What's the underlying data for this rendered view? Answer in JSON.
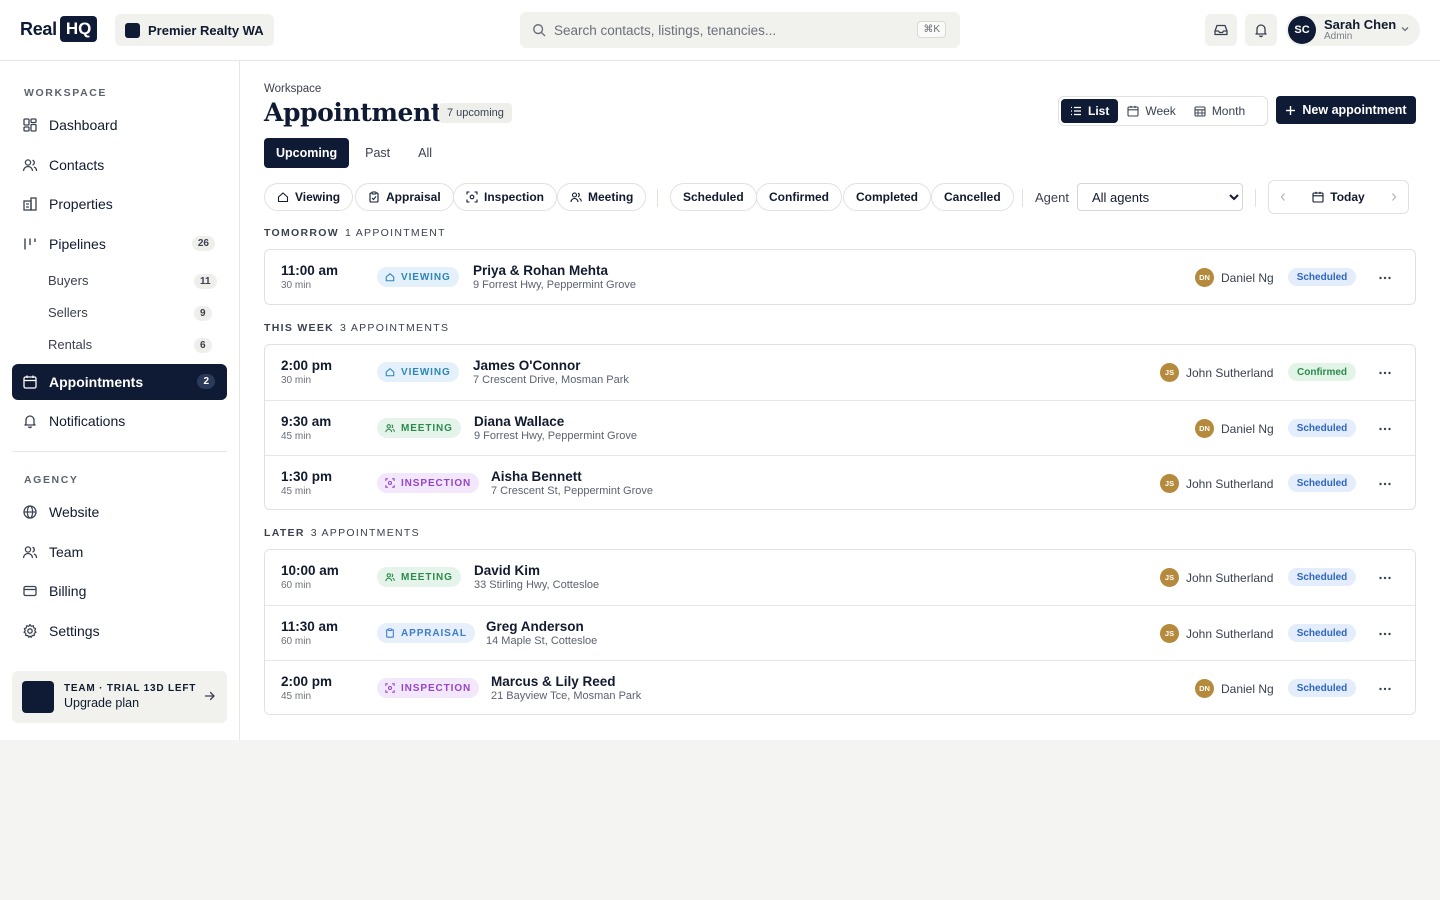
{
  "brand": {
    "real": "Real",
    "hq": "HQ"
  },
  "org": {
    "name": "Premier Realty WA"
  },
  "search": {
    "placeholder": "Search contacts, listings, tenancies...",
    "shortcut": "⌘K"
  },
  "user": {
    "initials": "SC",
    "name": "Sarah Chen",
    "role": "Admin"
  },
  "sidebar": {
    "workspace_label": "WORKSPACE",
    "agency_label": "AGENCY",
    "items": [
      {
        "label": "Dashboard"
      },
      {
        "label": "Contacts"
      },
      {
        "label": "Properties"
      },
      {
        "label": "Pipelines",
        "count": "26"
      },
      {
        "label": "Appointments",
        "count": "2"
      },
      {
        "label": "Notifications"
      }
    ],
    "pipelines": [
      {
        "label": "Buyers",
        "count": "11"
      },
      {
        "label": "Sellers",
        "count": "9"
      },
      {
        "label": "Rentals",
        "count": "6"
      }
    ],
    "agency_items": [
      {
        "label": "Website"
      },
      {
        "label": "Team"
      },
      {
        "label": "Billing"
      },
      {
        "label": "Settings"
      }
    ],
    "upgrade": {
      "line1": "TEAM · TRIAL 13D LEFT",
      "line2": "Upgrade plan"
    }
  },
  "page": {
    "breadcrumb": "Workspace",
    "title": "Appointments",
    "badge": "7 upcoming",
    "views": [
      "List",
      "Week",
      "Month"
    ],
    "new_button": "New appointment",
    "tabs": [
      "Upcoming",
      "Past",
      "All"
    ]
  },
  "filters": {
    "types": [
      "Viewing",
      "Appraisal",
      "Inspection",
      "Meeting"
    ],
    "statuses": [
      "Scheduled",
      "Confirmed",
      "Completed",
      "Cancelled"
    ],
    "agent_label": "Agent",
    "agent_value": "All agents",
    "today": "Today"
  },
  "groups": [
    {
      "title": "TOMORROW",
      "count": "1 APPOINTMENT",
      "rows": [
        {
          "time": "11:00 am",
          "duration": "30 min",
          "type": "VIEWING",
          "name": "Priya & Rohan Mehta",
          "address": "9 Forrest Hwy, Peppermint Grove",
          "agent_initials": "DN",
          "agent": "Daniel Ng",
          "status": "Scheduled"
        }
      ]
    },
    {
      "title": "THIS WEEK",
      "count": "3 APPOINTMENTS",
      "rows": [
        {
          "time": "2:00 pm",
          "duration": "30 min",
          "type": "VIEWING",
          "name": "James O'Connor",
          "address": "7 Crescent Drive, Mosman Park",
          "agent_initials": "JS",
          "agent": "John Sutherland",
          "status": "Confirmed"
        },
        {
          "time": "9:30 am",
          "duration": "45 min",
          "type": "MEETING",
          "name": "Diana Wallace",
          "address": "9 Forrest Hwy, Peppermint Grove",
          "agent_initials": "DN",
          "agent": "Daniel Ng",
          "status": "Scheduled"
        },
        {
          "time": "1:30 pm",
          "duration": "45 min",
          "type": "INSPECTION",
          "name": "Aisha Bennett",
          "address": "7 Crescent St, Peppermint Grove",
          "agent_initials": "JS",
          "agent": "John Sutherland",
          "status": "Scheduled"
        }
      ]
    },
    {
      "title": "LATER",
      "count": "3 APPOINTMENTS",
      "rows": [
        {
          "time": "10:00 am",
          "duration": "60 min",
          "type": "MEETING",
          "name": "David Kim",
          "address": "33 Stirling Hwy, Cottesloe",
          "agent_initials": "JS",
          "agent": "John Sutherland",
          "status": "Scheduled"
        },
        {
          "time": "11:30 am",
          "duration": "60 min",
          "type": "APPRAISAL",
          "name": "Greg Anderson",
          "address": "14 Maple St, Cottesloe",
          "agent_initials": "JS",
          "agent": "John Sutherland",
          "status": "Scheduled"
        },
        {
          "time": "2:00 pm",
          "duration": "45 min",
          "type": "INSPECTION",
          "name": "Marcus & Lily Reed",
          "address": "21 Bayview Tce, Mosman Park",
          "agent_initials": "DN",
          "agent": "Daniel Ng",
          "status": "Scheduled"
        }
      ]
    }
  ]
}
